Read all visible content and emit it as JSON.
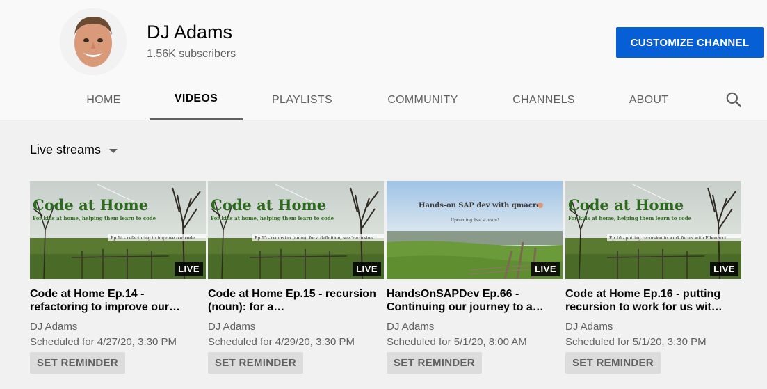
{
  "channel": {
    "name": "DJ Adams",
    "subscribers": "1.56K subscribers",
    "customize_label": "CUSTOMIZE CHANNEL",
    "avatar_icon": "avatar-photo-icon"
  },
  "tabs": [
    {
      "label": "HOME",
      "active": false
    },
    {
      "label": "VIDEOS",
      "active": true
    },
    {
      "label": "PLAYLISTS",
      "active": false
    },
    {
      "label": "COMMUNITY",
      "active": false
    },
    {
      "label": "CHANNELS",
      "active": false
    },
    {
      "label": "ABOUT",
      "active": false
    }
  ],
  "search_icon": "search-icon",
  "section": {
    "title": "Live streams",
    "dropdown_icon": "caret-down-icon"
  },
  "videos": [
    {
      "title": "Code at Home Ep.14 - refactoring to improve our…",
      "author": "DJ Adams",
      "scheduled": "Scheduled for 4/27/20, 3:30 PM",
      "reminder_label": "SET REMINDER",
      "badge": "LIVE",
      "thumb": {
        "heading": "Code at Home",
        "sub": "For kids at home, helping them learn to code",
        "strip": "Ep.14 - refactoring to improve our code"
      }
    },
    {
      "title": "Code at Home Ep.15 - recursion (noun): for a…",
      "author": "DJ Adams",
      "scheduled": "Scheduled for 4/29/20, 3:30 PM",
      "reminder_label": "SET REMINDER",
      "badge": "LIVE",
      "thumb": {
        "heading": "Code at Home",
        "sub": "For kids at home, helping them learn to code",
        "strip": "Ep.15 - recursion (noun): for a definition, see 'recursion'"
      }
    },
    {
      "title": "HandsOnSAPDev Ep.66 - Continuing our journey to a…",
      "author": "DJ Adams",
      "scheduled": "Scheduled for 5/1/20, 8:00 AM",
      "reminder_label": "SET REMINDER",
      "badge": "LIVE",
      "thumb": {
        "heading": "Hands-on SAP dev with qmacro",
        "sub": "Upcoming live stream!",
        "strip": ""
      }
    },
    {
      "title": "Code at Home Ep.16 - putting recursion to work for us wit…",
      "author": "DJ Adams",
      "scheduled": "Scheduled for 5/1/20, 3:30 PM",
      "reminder_label": "SET REMINDER",
      "badge": "LIVE",
      "thumb": {
        "heading": "Code at Home",
        "sub": "For kids at home, helping them learn to code",
        "strip": "Ep.16 - putting recursion to work for us with Fibonacci"
      }
    }
  ],
  "colors": {
    "accent": "#065fd4",
    "thumb_heading": "#2d6a1f"
  }
}
